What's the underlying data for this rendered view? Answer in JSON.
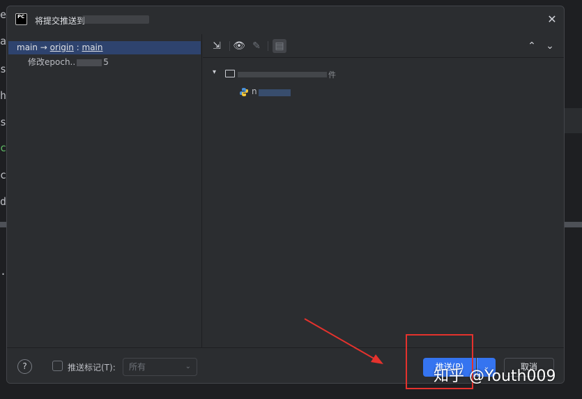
{
  "background": {
    "letters": [
      "e",
      "a",
      "s",
      "h",
      "s",
      "c",
      "c",
      "d",
      "."
    ]
  },
  "dialog": {
    "app_icon_text": "PC",
    "title": "将提交推送到",
    "close_icon": "close-icon"
  },
  "left_panel": {
    "branch": {
      "local": "main",
      "arrow": " → ",
      "remote": "origin",
      "sep": " : ",
      "target": "main"
    },
    "commit_prefix": "修改epoch..",
    "commit_suffix": "5"
  },
  "toolbar": {
    "icons": [
      "collapse-arrows-icon",
      "eye-icon",
      "pencil-icon",
      "calendar-icon",
      "expand-all-icon",
      "collapse-all-icon"
    ]
  },
  "tree": {
    "folder_suffix": "件",
    "file_initial": "n"
  },
  "footer": {
    "help_label": "?",
    "push_tags_label": "推送标记(T):",
    "tags_select_value": "所有",
    "push_button_label": "推送(P)",
    "cancel_button_label": "取消"
  },
  "overlay": {
    "watermark": "知乎 @Youth009",
    "accent_color": "#e5322d"
  },
  "colors": {
    "selection": "#2e436e",
    "primary_button": "#3574f0",
    "dialog_bg": "#2b2d30"
  }
}
